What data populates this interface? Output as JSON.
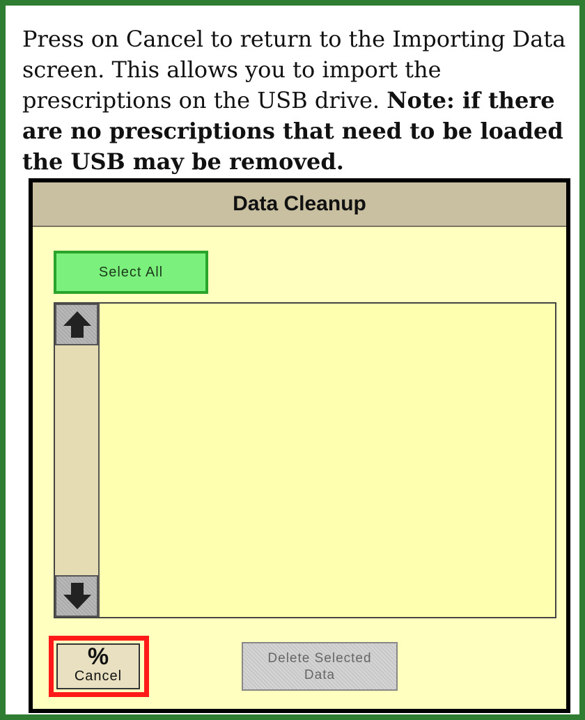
{
  "instruction": {
    "normal": "Press on Cancel to return to the Importing Data screen. This allows you to import the prescriptions on the USB drive.",
    "note": "Note: if there are no prescriptions that need to be loaded the USB may be removed."
  },
  "dialog": {
    "title": "Data Cleanup",
    "select_all_label": "Select All",
    "cancel_label": "Cancel",
    "cancel_icon": "cancel-percent-icon",
    "delete_label_line1": "Delete Selected",
    "delete_label_line2": "Data",
    "scroll_up_icon": "arrow-up-icon",
    "scroll_down_icon": "arrow-down-icon",
    "list_items": []
  },
  "colors": {
    "frame_border": "#2e7d32",
    "dialog_bg": "#ffffc0",
    "titlebar_bg": "#c8c0a0",
    "select_all_bg": "#7cf07c",
    "highlight": "#ff1a1a"
  }
}
